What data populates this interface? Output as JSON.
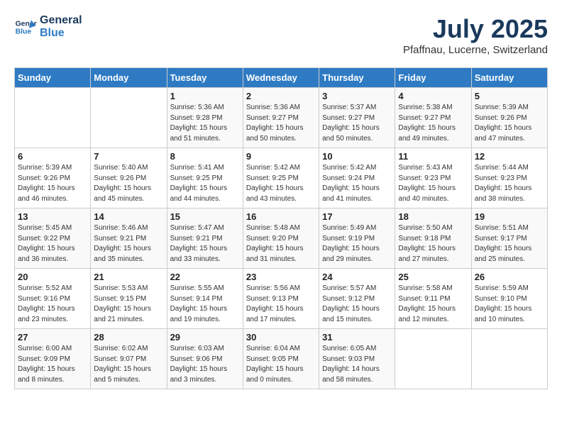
{
  "logo": {
    "line1": "General",
    "line2": "Blue"
  },
  "title": "July 2025",
  "location": "Pfaffnau, Lucerne, Switzerland",
  "weekdays": [
    "Sunday",
    "Monday",
    "Tuesday",
    "Wednesday",
    "Thursday",
    "Friday",
    "Saturday"
  ],
  "weeks": [
    [
      {
        "day": "",
        "info": ""
      },
      {
        "day": "",
        "info": ""
      },
      {
        "day": "1",
        "info": "Sunrise: 5:36 AM\nSunset: 9:28 PM\nDaylight: 15 hours and 51 minutes."
      },
      {
        "day": "2",
        "info": "Sunrise: 5:36 AM\nSunset: 9:27 PM\nDaylight: 15 hours and 50 minutes."
      },
      {
        "day": "3",
        "info": "Sunrise: 5:37 AM\nSunset: 9:27 PM\nDaylight: 15 hours and 50 minutes."
      },
      {
        "day": "4",
        "info": "Sunrise: 5:38 AM\nSunset: 9:27 PM\nDaylight: 15 hours and 49 minutes."
      },
      {
        "day": "5",
        "info": "Sunrise: 5:39 AM\nSunset: 9:26 PM\nDaylight: 15 hours and 47 minutes."
      }
    ],
    [
      {
        "day": "6",
        "info": "Sunrise: 5:39 AM\nSunset: 9:26 PM\nDaylight: 15 hours and 46 minutes."
      },
      {
        "day": "7",
        "info": "Sunrise: 5:40 AM\nSunset: 9:26 PM\nDaylight: 15 hours and 45 minutes."
      },
      {
        "day": "8",
        "info": "Sunrise: 5:41 AM\nSunset: 9:25 PM\nDaylight: 15 hours and 44 minutes."
      },
      {
        "day": "9",
        "info": "Sunrise: 5:42 AM\nSunset: 9:25 PM\nDaylight: 15 hours and 43 minutes."
      },
      {
        "day": "10",
        "info": "Sunrise: 5:42 AM\nSunset: 9:24 PM\nDaylight: 15 hours and 41 minutes."
      },
      {
        "day": "11",
        "info": "Sunrise: 5:43 AM\nSunset: 9:23 PM\nDaylight: 15 hours and 40 minutes."
      },
      {
        "day": "12",
        "info": "Sunrise: 5:44 AM\nSunset: 9:23 PM\nDaylight: 15 hours and 38 minutes."
      }
    ],
    [
      {
        "day": "13",
        "info": "Sunrise: 5:45 AM\nSunset: 9:22 PM\nDaylight: 15 hours and 36 minutes."
      },
      {
        "day": "14",
        "info": "Sunrise: 5:46 AM\nSunset: 9:21 PM\nDaylight: 15 hours and 35 minutes."
      },
      {
        "day": "15",
        "info": "Sunrise: 5:47 AM\nSunset: 9:21 PM\nDaylight: 15 hours and 33 minutes."
      },
      {
        "day": "16",
        "info": "Sunrise: 5:48 AM\nSunset: 9:20 PM\nDaylight: 15 hours and 31 minutes."
      },
      {
        "day": "17",
        "info": "Sunrise: 5:49 AM\nSunset: 9:19 PM\nDaylight: 15 hours and 29 minutes."
      },
      {
        "day": "18",
        "info": "Sunrise: 5:50 AM\nSunset: 9:18 PM\nDaylight: 15 hours and 27 minutes."
      },
      {
        "day": "19",
        "info": "Sunrise: 5:51 AM\nSunset: 9:17 PM\nDaylight: 15 hours and 25 minutes."
      }
    ],
    [
      {
        "day": "20",
        "info": "Sunrise: 5:52 AM\nSunset: 9:16 PM\nDaylight: 15 hours and 23 minutes."
      },
      {
        "day": "21",
        "info": "Sunrise: 5:53 AM\nSunset: 9:15 PM\nDaylight: 15 hours and 21 minutes."
      },
      {
        "day": "22",
        "info": "Sunrise: 5:55 AM\nSunset: 9:14 PM\nDaylight: 15 hours and 19 minutes."
      },
      {
        "day": "23",
        "info": "Sunrise: 5:56 AM\nSunset: 9:13 PM\nDaylight: 15 hours and 17 minutes."
      },
      {
        "day": "24",
        "info": "Sunrise: 5:57 AM\nSunset: 9:12 PM\nDaylight: 15 hours and 15 minutes."
      },
      {
        "day": "25",
        "info": "Sunrise: 5:58 AM\nSunset: 9:11 PM\nDaylight: 15 hours and 12 minutes."
      },
      {
        "day": "26",
        "info": "Sunrise: 5:59 AM\nSunset: 9:10 PM\nDaylight: 15 hours and 10 minutes."
      }
    ],
    [
      {
        "day": "27",
        "info": "Sunrise: 6:00 AM\nSunset: 9:09 PM\nDaylight: 15 hours and 8 minutes."
      },
      {
        "day": "28",
        "info": "Sunrise: 6:02 AM\nSunset: 9:07 PM\nDaylight: 15 hours and 5 minutes."
      },
      {
        "day": "29",
        "info": "Sunrise: 6:03 AM\nSunset: 9:06 PM\nDaylight: 15 hours and 3 minutes."
      },
      {
        "day": "30",
        "info": "Sunrise: 6:04 AM\nSunset: 9:05 PM\nDaylight: 15 hours and 0 minutes."
      },
      {
        "day": "31",
        "info": "Sunrise: 6:05 AM\nSunset: 9:03 PM\nDaylight: 14 hours and 58 minutes."
      },
      {
        "day": "",
        "info": ""
      },
      {
        "day": "",
        "info": ""
      }
    ]
  ]
}
